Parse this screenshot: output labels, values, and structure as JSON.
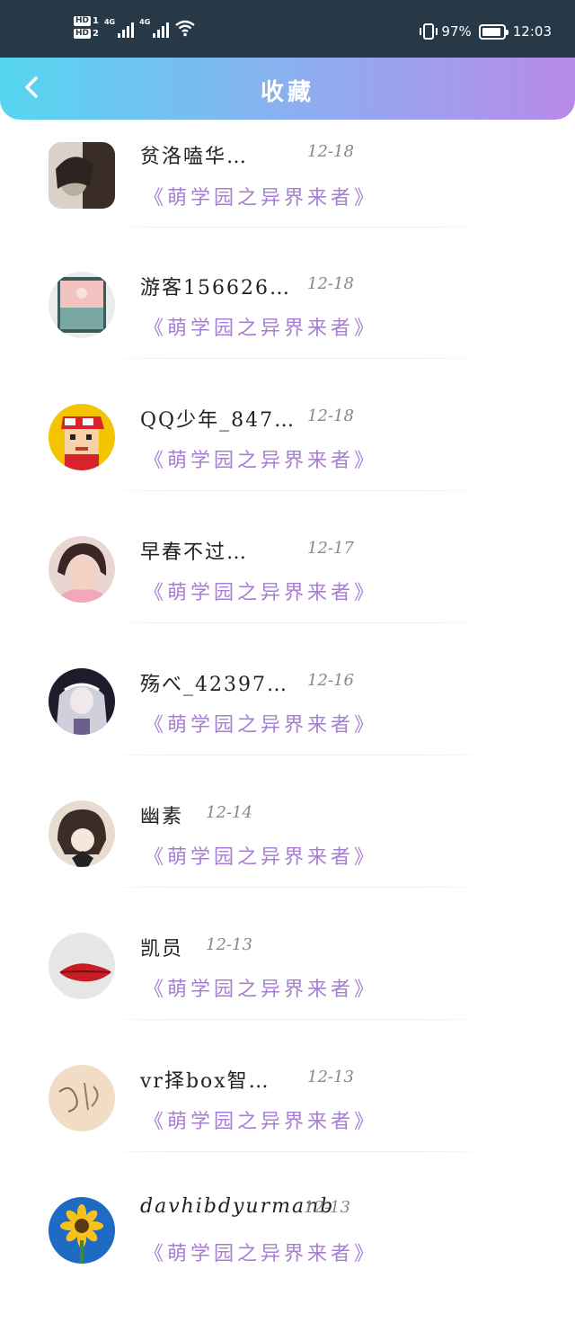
{
  "status_bar": {
    "hd1": "HD",
    "hd1_num": "1",
    "hd2": "HD",
    "hd2_num": "2",
    "network1": "4G",
    "network2": "4G",
    "battery": "97%",
    "time": "12:03"
  },
  "header": {
    "title": "收藏",
    "back_icon": "chevron-left-icon"
  },
  "items": [
    {
      "name": "贫洛嗑华…",
      "date": "12-18",
      "work": "《萌学园之异界来者》",
      "avatar": "dark-portrait"
    },
    {
      "name": "游客156626…",
      "date": "12-18",
      "work": "《萌学园之异界来者》",
      "avatar": "phone-landscape"
    },
    {
      "name": "QQ少年_847…",
      "date": "12-18",
      "work": "《萌学园之异界来者》",
      "avatar": "pixel-boy"
    },
    {
      "name": "早春不过…",
      "date": "12-17",
      "work": "《萌学园之异界来者》",
      "avatar": "girl-photo"
    },
    {
      "name": "殇べ_42397…",
      "date": "12-16",
      "work": "《萌学园之异界来者》",
      "avatar": "anime-lace"
    },
    {
      "name": "幽素",
      "date": "12-14",
      "work": "《萌学园之异界来者》",
      "avatar": "anime-girl"
    },
    {
      "name": "凯员",
      "date": "12-13",
      "work": "《萌学园之异界来者》",
      "avatar": "red-lips"
    },
    {
      "name": "vr择box智…",
      "date": "12-13",
      "work": "《萌学园之异界来者》",
      "avatar": "sketch-paper"
    },
    {
      "name": "davhibdyurmanb",
      "date": "12-13",
      "work": "《萌学园之异界来者》",
      "avatar": "sunflower"
    }
  ],
  "colors": {
    "header_gradient": [
      "#55d6f0",
      "#b88ae8"
    ],
    "work_title": "#a77fd2",
    "status_bar": "#273847"
  }
}
